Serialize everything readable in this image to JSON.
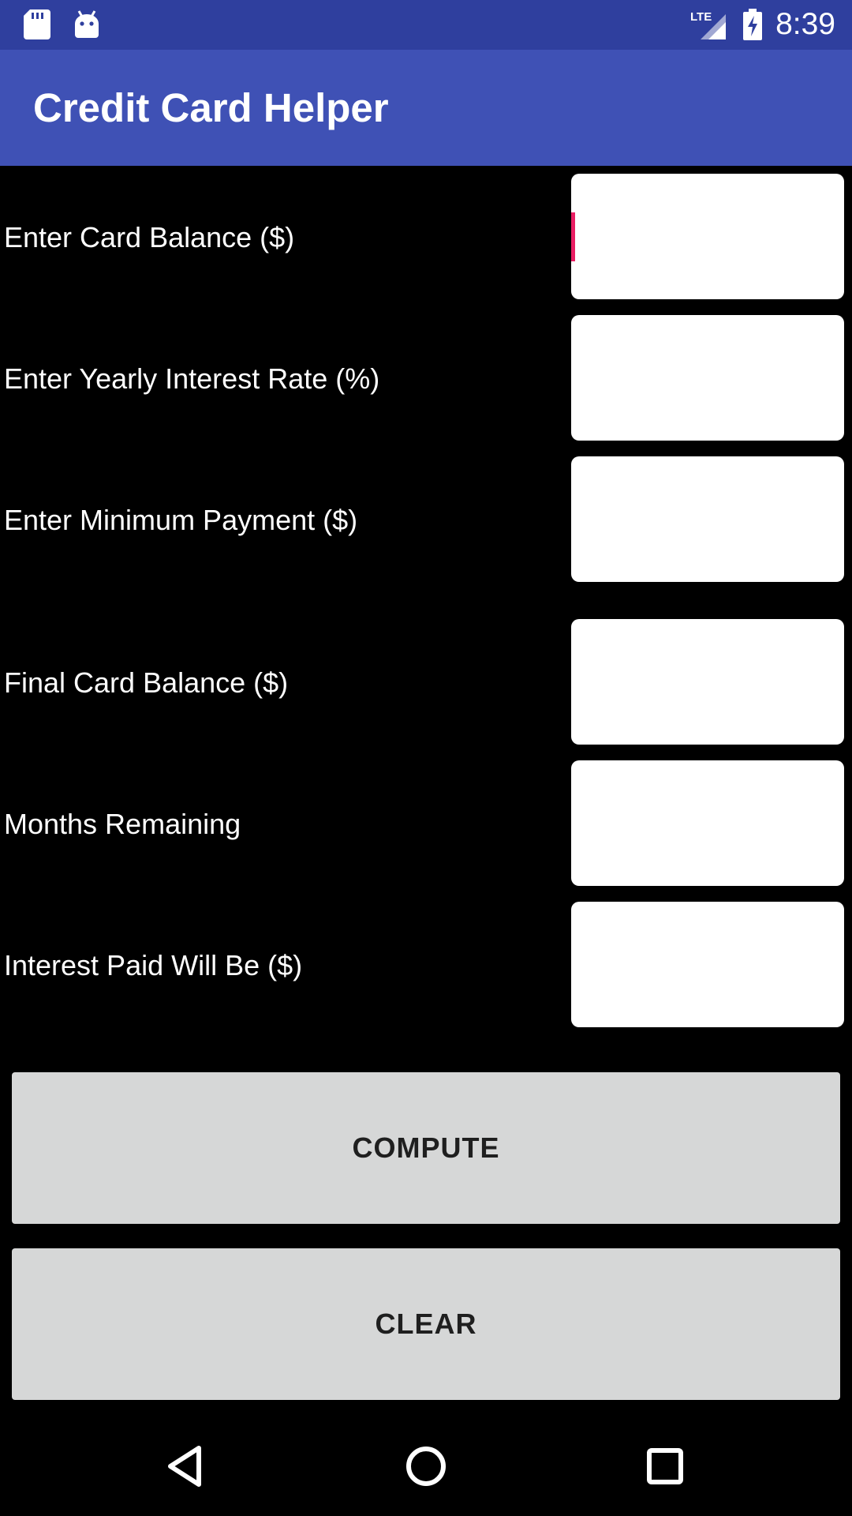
{
  "status_bar": {
    "time": "8:39",
    "network": "LTE",
    "icons": [
      "sd-card-icon",
      "android-debug-icon",
      "lte-signal-icon",
      "battery-charging-icon"
    ]
  },
  "app_bar": {
    "title": "Credit Card Helper",
    "color": "#3f51b5"
  },
  "form": {
    "rows": [
      {
        "label": "Enter Card Balance ($)",
        "value": "",
        "focused": true
      },
      {
        "label": "Enter Yearly Interest Rate (%)",
        "value": ""
      },
      {
        "label": "Enter Minimum Payment ($)",
        "value": ""
      },
      {
        "label": "Final Card Balance ($)",
        "value": ""
      },
      {
        "label": "Months Remaining",
        "value": ""
      },
      {
        "label": "Interest Paid Will Be ($)",
        "value": ""
      }
    ]
  },
  "buttons": {
    "compute_label": "COMPUTE",
    "clear_label": "CLEAR"
  },
  "nav_bar": {
    "icons": [
      "back-icon",
      "home-icon",
      "recents-icon"
    ]
  },
  "colors": {
    "status_bar": "#2f3f9e",
    "accent_cursor": "#e91e63",
    "button_bg": "#d6d7d7",
    "background": "#000000"
  }
}
